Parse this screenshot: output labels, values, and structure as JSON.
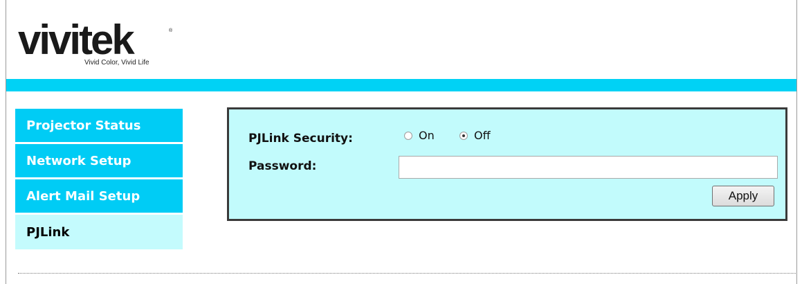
{
  "brand": {
    "name": "vivitek",
    "tagline": "Vivid Color, Vivid Life",
    "colors": {
      "text": "#111111",
      "accent": "#00c8f0"
    }
  },
  "colors": {
    "bar": "#00d2f5",
    "nav_inactive_bg": "#00ccf5",
    "nav_active_bg": "#c4fbfd",
    "panel_bg": "#c2fbfc"
  },
  "nav": {
    "items": [
      {
        "label": "Projector Status",
        "active": false
      },
      {
        "label": "Network Setup",
        "active": false
      },
      {
        "label": "Alert Mail Setup",
        "active": false
      },
      {
        "label": "PJLink",
        "active": true
      }
    ]
  },
  "form": {
    "security_label": "PJLink Security:",
    "security_options": [
      {
        "label": "On",
        "checked": false
      },
      {
        "label": "Off",
        "checked": true
      }
    ],
    "password_label": "Password:",
    "password_value": "",
    "apply_label": "Apply"
  }
}
